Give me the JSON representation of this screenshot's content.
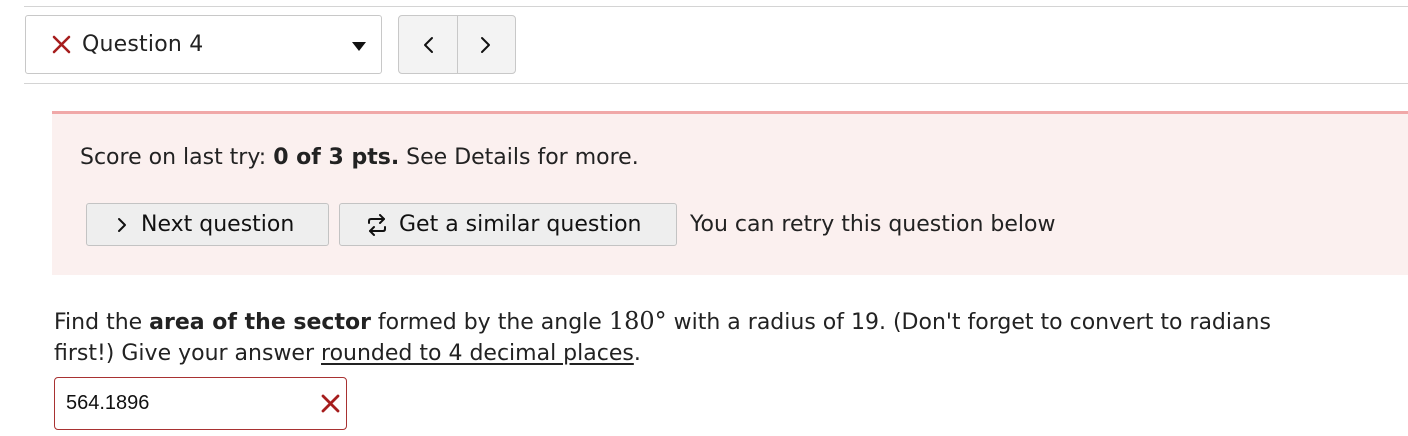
{
  "nav": {
    "question_select": {
      "label": "Question 4"
    },
    "prev_label": "<",
    "next_label": ">"
  },
  "score_panel": {
    "prefix": "Score on last try: ",
    "score": "0 of 3 pts.",
    "suffix": " See Details for more.",
    "next_button": "Next question",
    "similar_button": "Get a similar question",
    "retry_note": "You can retry this question below"
  },
  "question": {
    "t1": "Find the ",
    "b1": "area of the sector",
    "t2": " formed by the angle ",
    "angle": "180°",
    "t3": " with a radius of 19. (Don't forget to convert to radians first!) Give your answer ",
    "u1": "rounded to 4 decimal places",
    "t4": "."
  },
  "answer": {
    "value": "564.1896"
  },
  "colors": {
    "error": "#a61d1d",
    "panel_bg": "#fbf0ef",
    "panel_border": "#f0a8a8"
  },
  "icons": {
    "question_status": "x-icon",
    "answer_status": "x-icon",
    "next": "chevron-right-icon",
    "similar": "retry-arrows-icon"
  }
}
